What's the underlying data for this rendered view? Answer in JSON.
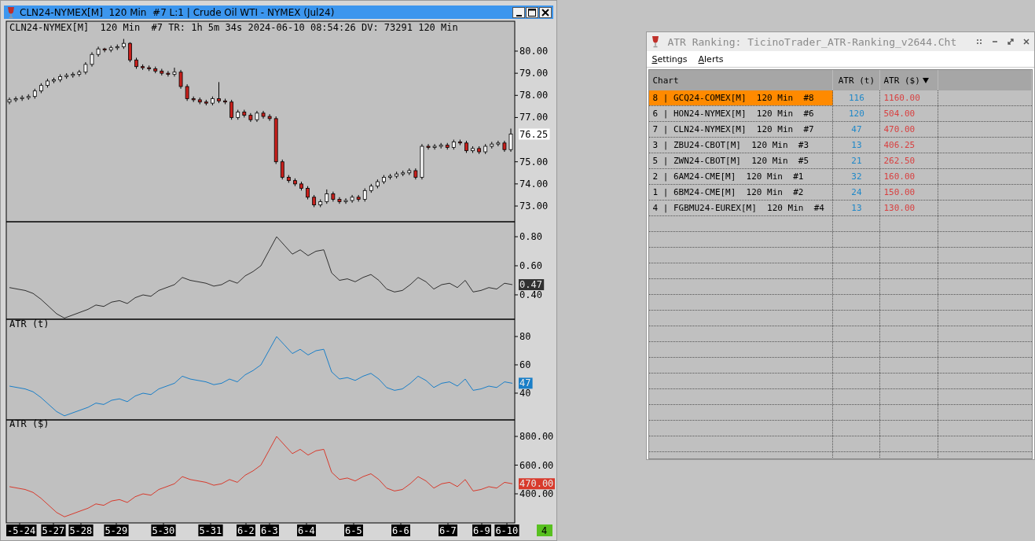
{
  "chart_window": {
    "title": "CLN24-NYMEX[M]  120 Min  #7 L:1 | Crude Oil WTI - NYMEX (Jul24)",
    "info_line": "CLN24-NYMEX[M]  120 Min  #7 TR: 1h 5m 34s 2024-06-10 08:54:26 DV: 73291 120 Min",
    "panes": [
      {
        "kind": "candles",
        "last_value": "76.25",
        "chart_data": {
          "type": "candlestick",
          "ylim": [
            72.29,
            81.35
          ],
          "categories": [
            null,
            null,
            null,
            null,
            null,
            null,
            null,
            null,
            null,
            null,
            null,
            null,
            null,
            null,
            null,
            null,
            null,
            null,
            null,
            null,
            null,
            null,
            null,
            null,
            null,
            null,
            null,
            null,
            null,
            null,
            null,
            null,
            null,
            null,
            null,
            null,
            null,
            null,
            null,
            null,
            null,
            null,
            null,
            null,
            null,
            null,
            null,
            null,
            null,
            null,
            null,
            null,
            null,
            null,
            null,
            null,
            null,
            null,
            null,
            null,
            null,
            null,
            null,
            null,
            null,
            null,
            null,
            null,
            null,
            null,
            null,
            null,
            null,
            null,
            null,
            null,
            null,
            null,
            null,
            null
          ],
          "yticks": [
            {
              "value": 80,
              "label": "80.00"
            },
            {
              "value": 79,
              "label": "79.00"
            },
            {
              "value": 78,
              "label": "78.00"
            },
            {
              "value": 77,
              "label": "77.00"
            },
            {
              "value": 75,
              "label": "75.00"
            },
            {
              "value": 74,
              "label": "74.00"
            },
            {
              "value": 73,
              "label": "73.00"
            }
          ],
          "ohlc": [
            [
              77.7,
              77.9,
              77.6,
              77.8
            ],
            [
              77.8,
              77.95,
              77.7,
              77.85
            ],
            [
              77.85,
              78.0,
              77.75,
              77.9
            ],
            [
              77.9,
              78.05,
              77.8,
              77.95
            ],
            [
              77.95,
              78.3,
              77.85,
              78.2
            ],
            [
              78.2,
              78.55,
              78.1,
              78.45
            ],
            [
              78.45,
              78.75,
              78.35,
              78.65
            ],
            [
              78.65,
              78.8,
              78.55,
              78.7
            ],
            [
              78.7,
              78.95,
              78.6,
              78.85
            ],
            [
              78.85,
              79.0,
              78.75,
              78.9
            ],
            [
              78.9,
              79.05,
              78.8,
              78.95
            ],
            [
              78.95,
              79.15,
              78.85,
              79.05
            ],
            [
              79.05,
              79.5,
              78.95,
              79.4
            ],
            [
              79.4,
              79.95,
              79.3,
              79.85
            ],
            [
              79.85,
              80.2,
              79.75,
              80.1
            ],
            [
              80.1,
              80.15,
              79.95,
              80.05
            ],
            [
              80.05,
              80.25,
              79.95,
              80.15
            ],
            [
              80.15,
              80.3,
              80.05,
              80.2
            ],
            [
              80.2,
              80.55,
              80.1,
              80.35
            ],
            [
              80.35,
              80.4,
              79.5,
              79.6
            ],
            [
              79.6,
              79.7,
              79.2,
              79.3
            ],
            [
              79.3,
              79.4,
              79.15,
              79.25
            ],
            [
              79.25,
              79.35,
              79.1,
              79.2
            ],
            [
              79.2,
              79.3,
              79.0,
              79.1
            ],
            [
              79.1,
              79.2,
              78.9,
              79.0
            ],
            [
              79.0,
              79.1,
              78.85,
              78.95
            ],
            [
              78.95,
              79.25,
              78.85,
              79.05
            ],
            [
              79.05,
              79.15,
              78.3,
              78.4
            ],
            [
              78.4,
              78.5,
              77.75,
              77.85
            ],
            [
              77.85,
              77.95,
              77.7,
              77.8
            ],
            [
              77.8,
              77.9,
              77.6,
              77.7
            ],
            [
              77.7,
              77.8,
              77.55,
              77.65
            ],
            [
              77.65,
              77.95,
              77.55,
              77.85
            ],
            [
              77.85,
              78.6,
              77.65,
              77.75
            ],
            [
              77.75,
              77.85,
              77.6,
              77.7
            ],
            [
              77.7,
              77.8,
              76.9,
              77.0
            ],
            [
              77.0,
              77.35,
              76.9,
              77.25
            ],
            [
              77.25,
              77.35,
              77.0,
              77.1
            ],
            [
              77.1,
              77.2,
              76.8,
              76.9
            ],
            [
              76.9,
              77.3,
              76.8,
              77.2
            ],
            [
              77.2,
              77.3,
              76.95,
              77.05
            ],
            [
              77.05,
              77.15,
              76.85,
              76.95
            ],
            [
              76.95,
              77.05,
              74.9,
              75.0
            ],
            [
              75.0,
              75.1,
              74.2,
              74.3
            ],
            [
              74.3,
              74.4,
              74.05,
              74.15
            ],
            [
              74.15,
              74.25,
              73.9,
              74.0
            ],
            [
              74.0,
              74.1,
              73.7,
              73.8
            ],
            [
              73.8,
              73.9,
              73.3,
              73.4
            ],
            [
              73.4,
              73.5,
              72.95,
              73.05
            ],
            [
              73.05,
              73.3,
              72.95,
              73.2
            ],
            [
              73.2,
              73.75,
              73.1,
              73.55
            ],
            [
              73.55,
              73.65,
              73.2,
              73.3
            ],
            [
              73.3,
              73.4,
              73.1,
              73.2
            ],
            [
              73.2,
              73.35,
              73.1,
              73.25
            ],
            [
              73.25,
              73.5,
              73.15,
              73.4
            ],
            [
              73.4,
              73.5,
              73.2,
              73.3
            ],
            [
              73.3,
              73.8,
              73.2,
              73.7
            ],
            [
              73.7,
              74.0,
              73.6,
              73.9
            ],
            [
              73.9,
              74.2,
              73.8,
              74.1
            ],
            [
              74.1,
              74.4,
              74.0,
              74.3
            ],
            [
              74.3,
              74.45,
              74.2,
              74.35
            ],
            [
              74.35,
              74.55,
              74.25,
              74.45
            ],
            [
              74.45,
              74.6,
              74.35,
              74.5
            ],
            [
              74.5,
              74.7,
              74.4,
              74.6
            ],
            [
              74.6,
              74.7,
              74.2,
              74.3
            ],
            [
              74.3,
              75.8,
              74.2,
              75.7
            ],
            [
              75.7,
              75.8,
              75.55,
              75.65
            ],
            [
              75.65,
              75.8,
              75.55,
              75.7
            ],
            [
              75.7,
              75.85,
              75.6,
              75.75
            ],
            [
              75.75,
              75.85,
              75.55,
              75.65
            ],
            [
              75.65,
              76.0,
              75.55,
              75.9
            ],
            [
              75.9,
              76.0,
              75.75,
              75.85
            ],
            [
              75.85,
              75.95,
              75.4,
              75.5
            ],
            [
              75.5,
              75.7,
              75.4,
              75.6
            ],
            [
              75.6,
              75.7,
              75.35,
              75.45
            ],
            [
              75.45,
              75.8,
              75.35,
              75.7
            ],
            [
              75.7,
              75.9,
              75.6,
              75.8
            ],
            [
              75.8,
              75.95,
              75.7,
              75.85
            ],
            [
              75.85,
              75.95,
              75.45,
              75.55
            ],
            [
              75.55,
              76.5,
              75.45,
              76.25
            ]
          ]
        }
      },
      {
        "kind": "line",
        "last_value": "0.47",
        "chart_data": {
          "type": "line",
          "ylim": [
            0.232,
            0.903
          ],
          "categories": [
            null,
            null,
            null,
            null,
            null,
            null,
            null,
            null,
            null,
            null,
            null,
            null,
            null,
            null,
            null,
            null,
            null,
            null,
            null,
            null,
            null,
            null,
            null,
            null,
            null,
            null,
            null,
            null,
            null,
            null,
            null,
            null,
            null,
            null,
            null,
            null,
            null,
            null,
            null,
            null,
            null,
            null,
            null,
            null,
            null,
            null,
            null,
            null,
            null,
            null,
            null,
            null,
            null,
            null,
            null,
            null,
            null,
            null,
            null,
            null,
            null,
            null,
            null,
            null,
            null
          ],
          "yticks": [
            {
              "value": 0.8,
              "label": "0.80"
            },
            {
              "value": 0.6,
              "label": "0.60"
            },
            {
              "value": 0.4,
              "label": "0.40"
            }
          ],
          "series": [
            {
              "color": "#303030",
              "values": [
                0.45,
                0.44,
                0.43,
                0.41,
                0.37,
                0.32,
                0.27,
                0.24,
                0.26,
                0.28,
                0.3,
                0.33,
                0.32,
                0.35,
                0.36,
                0.34,
                0.38,
                0.4,
                0.39,
                0.43,
                0.45,
                0.47,
                0.52,
                0.5,
                0.49,
                0.48,
                0.46,
                0.47,
                0.5,
                0.48,
                0.53,
                0.56,
                0.6,
                0.7,
                0.8,
                0.74,
                0.68,
                0.71,
                0.67,
                0.7,
                0.71,
                0.55,
                0.5,
                0.51,
                0.49,
                0.52,
                0.54,
                0.5,
                0.44,
                0.42,
                0.43,
                0.47,
                0.52,
                0.49,
                0.44,
                0.47,
                0.48,
                0.45,
                0.5,
                0.42,
                0.43,
                0.45,
                0.44,
                0.48,
                0.47
              ]
            }
          ]
        }
      },
      {
        "kind": "line",
        "label": "ATR (t)",
        "last_value": "47",
        "chart_data": {
          "type": "line",
          "ylim": [
            21.1,
            92.2
          ],
          "categories": [
            null,
            null,
            null,
            null,
            null,
            null,
            null,
            null,
            null,
            null,
            null,
            null,
            null,
            null,
            null,
            null,
            null,
            null,
            null,
            null,
            null,
            null,
            null,
            null,
            null,
            null,
            null,
            null,
            null,
            null,
            null,
            null,
            null,
            null,
            null,
            null,
            null,
            null,
            null,
            null,
            null,
            null,
            null,
            null,
            null,
            null,
            null,
            null,
            null,
            null,
            null,
            null,
            null,
            null,
            null,
            null,
            null,
            null,
            null,
            null,
            null,
            null,
            null,
            null,
            null
          ],
          "yticks": [
            {
              "value": 80,
              "label": "80"
            },
            {
              "value": 60,
              "label": "60"
            },
            {
              "value": 40,
              "label": "40"
            }
          ],
          "series": [
            {
              "color": "#1a7fc8",
              "values": [
                45,
                44,
                43,
                41,
                37,
                32,
                27,
                24,
                26,
                28,
                30,
                33,
                32,
                35,
                36,
                34,
                38,
                40,
                39,
                43,
                45,
                47,
                52,
                50,
                49,
                48,
                46,
                47,
                50,
                48,
                53,
                56,
                60,
                70,
                80,
                74,
                68,
                71,
                67,
                70,
                71,
                55,
                50,
                51,
                49,
                52,
                54,
                50,
                44,
                42,
                43,
                47,
                52,
                49,
                44,
                47,
                48,
                45,
                50,
                42,
                43,
                45,
                44,
                48,
                47
              ]
            }
          ]
        }
      },
      {
        "kind": "line",
        "label": "ATR ($)",
        "last_value": "470.00",
        "chart_data": {
          "type": "line",
          "ylim": [
            197.3,
            915.1
          ],
          "categories": [
            null,
            null,
            null,
            null,
            null,
            null,
            null,
            null,
            null,
            null,
            null,
            null,
            null,
            null,
            null,
            null,
            null,
            null,
            null,
            null,
            null,
            null,
            null,
            null,
            null,
            null,
            null,
            null,
            null,
            null,
            null,
            null,
            null,
            null,
            null,
            null,
            null,
            null,
            null,
            null,
            null,
            null,
            null,
            null,
            null,
            null,
            null,
            null,
            null,
            null,
            null,
            null,
            null,
            null,
            null,
            null,
            null,
            null,
            null,
            null,
            null,
            null,
            null,
            null,
            null
          ],
          "yticks": [
            {
              "value": 800,
              "label": "800.00"
            },
            {
              "value": 600,
              "label": "600.00"
            },
            {
              "value": 400,
              "label": "400.00"
            }
          ],
          "series": [
            {
              "color": "#d83a2c",
              "values": [
                450,
                440,
                430,
                410,
                370,
                320,
                270,
                240,
                260,
                280,
                300,
                330,
                320,
                350,
                360,
                340,
                380,
                400,
                390,
                430,
                450,
                470,
                520,
                500,
                490,
                480,
                460,
                470,
                500,
                480,
                530,
                560,
                600,
                700,
                800,
                740,
                680,
                710,
                670,
                700,
                710,
                550,
                500,
                510,
                490,
                520,
                540,
                500,
                440,
                420,
                430,
                470,
                520,
                490,
                440,
                470,
                480,
                450,
                500,
                420,
                430,
                450,
                440,
                480,
                470
              ]
            }
          ]
        }
      }
    ],
    "date_labels": [
      "-5-24",
      "5-27",
      "5-28",
      "5-29",
      "5-30",
      "5-31",
      "6-2",
      "6-3",
      "6-4",
      "6-5",
      "6-6",
      "6-7",
      "6-9",
      "6-10"
    ],
    "badge": "4"
  },
  "ranking_window": {
    "title": "ATR Ranking: TicinoTrader_ATR-Ranking_v2644.Cht",
    "menu": [
      "Settings",
      "Alerts"
    ],
    "columns": [
      {
        "label": "Chart",
        "sorted": false
      },
      {
        "label": "ATR (t)",
        "sorted": false
      },
      {
        "label": "ATR ($)",
        "sorted": true
      }
    ],
    "rows": [
      {
        "chart": "8 | GCQ24-COMEX[M]  120 Min  #8",
        "atr_t": "116",
        "atr_usd": "1160.00",
        "selected": true
      },
      {
        "chart": "6 | HON24-NYMEX[M]  120 Min  #6",
        "atr_t": "120",
        "atr_usd": "504.00",
        "selected": false
      },
      {
        "chart": "7 | CLN24-NYMEX[M]  120 Min  #7",
        "atr_t": "47",
        "atr_usd": "470.00",
        "selected": false
      },
      {
        "chart": "3 | ZBU24-CBOT[M]  120 Min  #3",
        "atr_t": "13",
        "atr_usd": "406.25",
        "selected": false
      },
      {
        "chart": "5 | ZWN24-CBOT[M]  120 Min  #5",
        "atr_t": "21",
        "atr_usd": "262.50",
        "selected": false
      },
      {
        "chart": "2 | 6AM24-CME[M]  120 Min  #1",
        "atr_t": "32",
        "atr_usd": "160.00",
        "selected": false
      },
      {
        "chart": "1 | 6BM24-CME[M]  120 Min  #2",
        "atr_t": "24",
        "atr_usd": "150.00",
        "selected": false
      },
      {
        "chart": "4 | FGBMU24-EUREX[M]  120 Min  #4",
        "atr_t": "13",
        "atr_usd": "130.00",
        "selected": false
      }
    ]
  }
}
